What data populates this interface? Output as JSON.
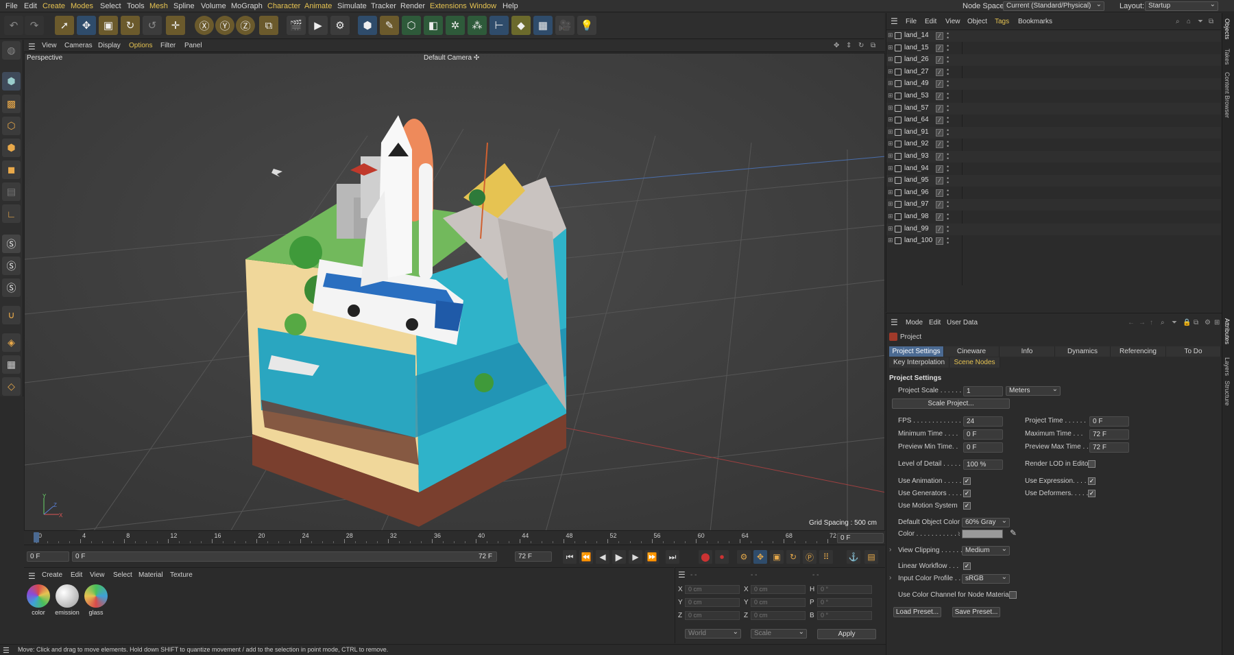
{
  "menu": {
    "items": [
      "File",
      "Edit",
      "Create",
      "Modes",
      "Select",
      "Tools",
      "Mesh",
      "Spline",
      "Volume",
      "MoGraph",
      "Character",
      "Animate",
      "Simulate",
      "Tracker",
      "Render",
      "Extensions",
      "Window",
      "Help"
    ],
    "node_space_label": "Node Space:",
    "node_space_value": "Current (Standard/Physical)",
    "layout_label": "Layout:",
    "layout_value": "Startup"
  },
  "viewport": {
    "menu": [
      "View",
      "Cameras",
      "Display",
      "Options",
      "Filter",
      "Panel"
    ],
    "projection": "Perspective",
    "camera": "Default Camera",
    "camera_suffix": "✣",
    "grid_spacing": "Grid Spacing : 500 cm",
    "axis_labels": {
      "y": "Y",
      "z": "Z",
      "x": "X"
    }
  },
  "timeline": {
    "ticks": [
      "0",
      "4",
      "8",
      "12",
      "16",
      "20",
      "24",
      "28",
      "32",
      "36",
      "40",
      "44",
      "48",
      "52",
      "56",
      "60",
      "64",
      "68",
      "72"
    ],
    "current_frame": "0 F",
    "start_field": "0 F",
    "preview_start": "0 F",
    "preview_end": "72 F",
    "end_field": "72 F"
  },
  "materials": {
    "menu": [
      "Create",
      "Edit",
      "View",
      "Select",
      "Material",
      "Texture"
    ],
    "items": [
      {
        "name": "color",
        "swatch": "#6a4fa0"
      },
      {
        "name": "emission",
        "swatch": "#e8e8e8"
      },
      {
        "name": "glass",
        "swatch": "#4f7fa0"
      }
    ]
  },
  "coordinates": {
    "rows": [
      {
        "a": "X",
        "av": "0 cm",
        "b": "X",
        "bv": "0 cm",
        "c": "H",
        "cv": "0 °"
      },
      {
        "a": "Y",
        "av": "0 cm",
        "b": "Y",
        "bv": "0 cm",
        "c": "P",
        "cv": "0 °"
      },
      {
        "a": "Z",
        "av": "0 cm",
        "b": "Z",
        "bv": "0 cm",
        "c": "B",
        "cv": "0 °"
      }
    ],
    "dash": "- -",
    "mode1": "World",
    "mode2": "Scale",
    "apply": "Apply"
  },
  "status": "Move: Click and drag to move elements. Hold down SHIFT to quantize movement / add to the selection in point mode, CTRL to remove.",
  "objects": {
    "menu": [
      "File",
      "Edit",
      "View",
      "Object",
      "Tags",
      "Bookmarks"
    ],
    "items": [
      "land_14",
      "land_15",
      "land_26",
      "land_27",
      "land_49",
      "land_53",
      "land_57",
      "land_64",
      "land_91",
      "land_92",
      "land_93",
      "land_94",
      "land_95",
      "land_96",
      "land_97",
      "land_98",
      "land_99",
      "land_100"
    ]
  },
  "attributes": {
    "menu": [
      "Mode",
      "Edit",
      "User Data"
    ],
    "object": "Project",
    "tabs": [
      "Project Settings",
      "Cineware",
      "Info",
      "Dynamics",
      "Referencing",
      "To Do"
    ],
    "tabs2": [
      "Key Interpolation",
      "Scene Nodes"
    ],
    "section": "Project Settings",
    "project_scale_label": "Project Scale . . . . . .",
    "project_scale_value": "1",
    "project_scale_unit": "Meters",
    "scale_project_button": "Scale Project...",
    "fps_label": "FPS . . . . . . . . . . . . . .",
    "fps_value": "24",
    "project_time_label": "Project Time . . . . . .",
    "project_time_value": "0 F",
    "min_time_label": "Minimum Time . . . .",
    "min_time_value": "0 F",
    "max_time_label": "Maximum Time . . .",
    "max_time_value": "72 F",
    "prev_min_label": "Preview Min Time. .",
    "prev_min_value": "0 F",
    "prev_max_label": "Preview Max Time . .",
    "prev_max_value": "72 F",
    "lod_label": "Level of Detail . . . . .",
    "lod_value": "100 %",
    "render_lod_label": "Render LOD in Editor",
    "use_animation": "Use Animation . . . . .",
    "use_expression": "Use Expression. . . . .",
    "use_generators": "Use Generators . . . .",
    "use_deformers": "Use Deformers. . . . .",
    "use_motion": "Use Motion System",
    "default_color_label": "Default Object Color",
    "default_color_value": "60% Gray",
    "color_label": "Color . . . . . . . . . . . . .",
    "view_clipping_label": "View Clipping . . . . . .",
    "view_clipping_value": "Medium",
    "linear_workflow": "Linear Workflow . . .",
    "input_profile_label": "Input Color Profile . . .",
    "input_profile_value": "sRGB",
    "use_color_channel": "Use Color Channel for Node Material",
    "load_preset": "Load Preset...",
    "save_preset": "Save Preset...",
    "check": "✓"
  },
  "side_tabs": [
    "Objects",
    "Takes",
    "Content Browser",
    "Attributes",
    "Layers",
    "Structure"
  ],
  "colors": {
    "accent": "#4b6a92",
    "highlight": "#e6c352"
  }
}
